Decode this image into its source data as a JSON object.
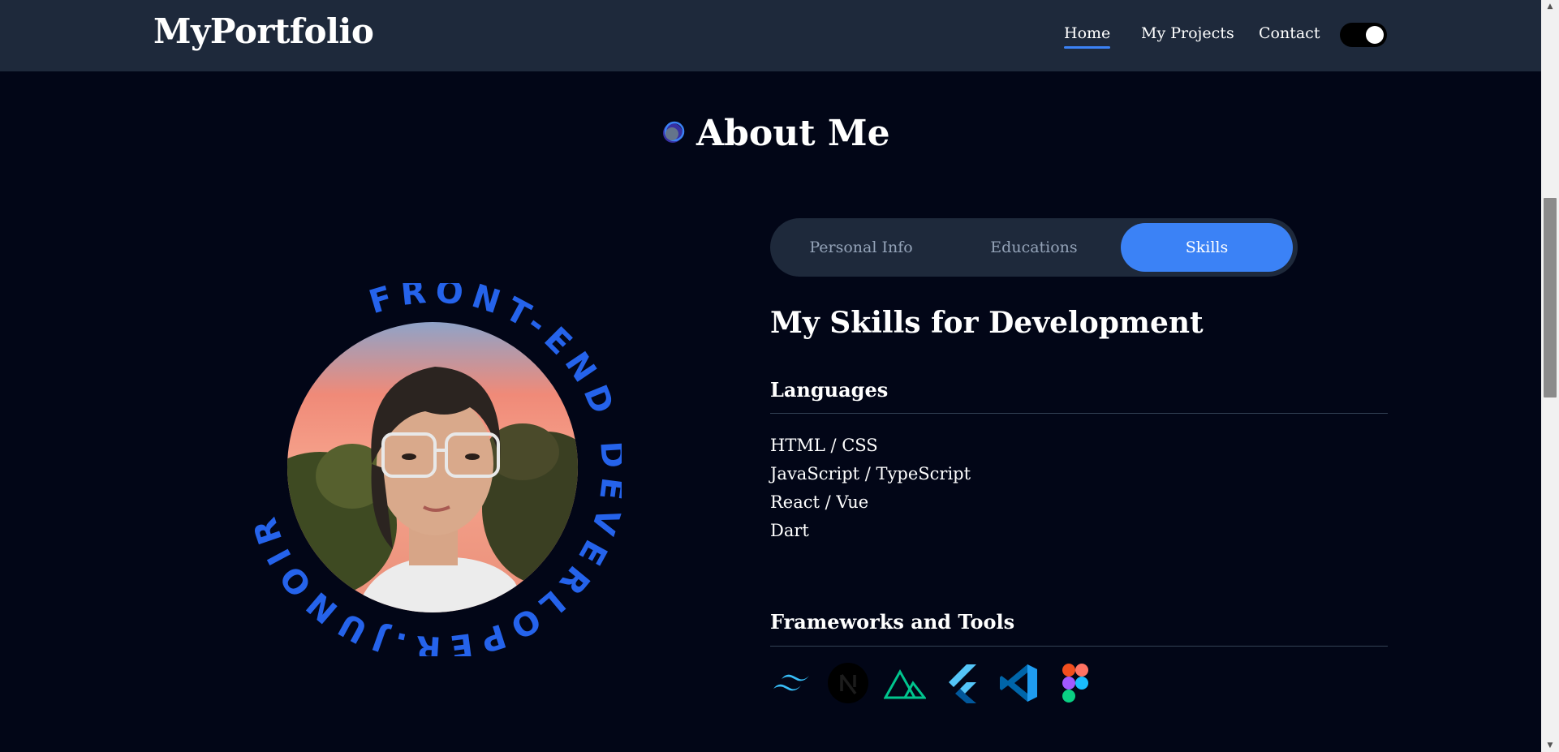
{
  "nav": {
    "logo": "MyPortfolio",
    "links": [
      {
        "label": "Home",
        "active": true
      },
      {
        "label": "My Projects",
        "active": false
      },
      {
        "label": "Contact",
        "active": false
      }
    ],
    "theme_toggle": {
      "icon": "toggle-switch-icon",
      "state": "on"
    }
  },
  "about": {
    "title": "About Me",
    "title_icon": "circle-icon",
    "avatar_ring_text": "FRONT-END DEVERLOPER.JUNOIR",
    "tabs": [
      {
        "label": "Personal Info",
        "active": false
      },
      {
        "label": "Educations",
        "active": false
      },
      {
        "label": "Skills",
        "active": true
      }
    ]
  },
  "skills": {
    "heading": "My Skills for Development",
    "languages_heading": "Languages",
    "languages": [
      "HTML / CSS",
      "JavaScript / TypeScript",
      "React / Vue",
      "Dart"
    ],
    "frameworks_heading": "Frameworks and Tools",
    "tools": [
      "tailwind-icon",
      "nextjs-icon",
      "nuxt-icon",
      "flutter-icon",
      "vscode-icon",
      "figma-icon"
    ]
  },
  "colors": {
    "background": "#020617",
    "navbar": "#1e293b",
    "accent": "#3b82f6",
    "ring_text": "#2563eb"
  }
}
